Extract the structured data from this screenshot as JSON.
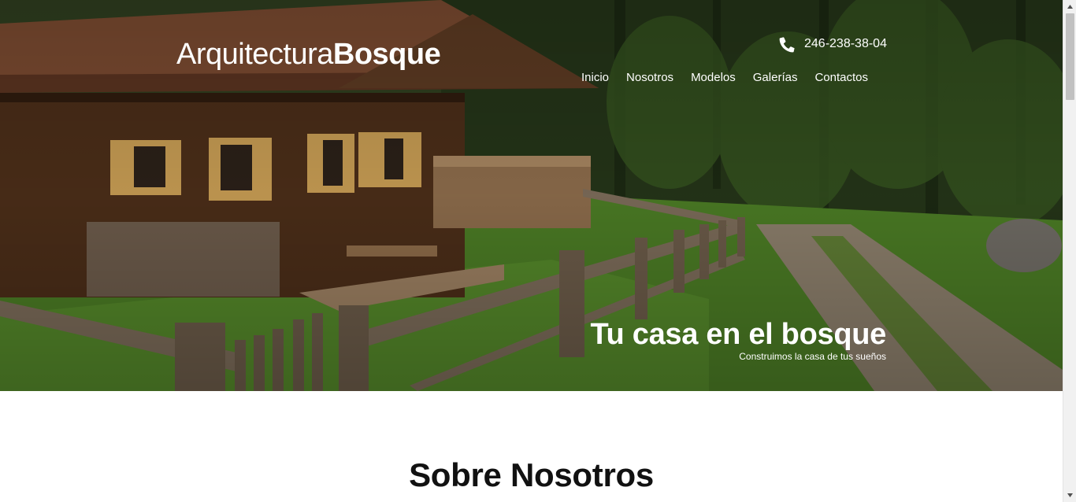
{
  "brand": {
    "light": "Arquitectura",
    "bold": "Bosque"
  },
  "contact": {
    "phone_icon": "phone-icon",
    "phone": "246-238-38-04"
  },
  "nav": {
    "items": [
      {
        "label": "Inicio"
      },
      {
        "label": "Nosotros"
      },
      {
        "label": "Modelos"
      },
      {
        "label": "Galerías"
      },
      {
        "label": "Contactos"
      }
    ]
  },
  "hero": {
    "title": "Tu casa en el bosque",
    "subtitle": "Construimos la casa de tus sueños"
  },
  "about": {
    "title": "Sobre Nosotros"
  },
  "colors": {
    "text_on_hero": "#ffffff",
    "heading": "#111111",
    "background": "#ffffff"
  }
}
